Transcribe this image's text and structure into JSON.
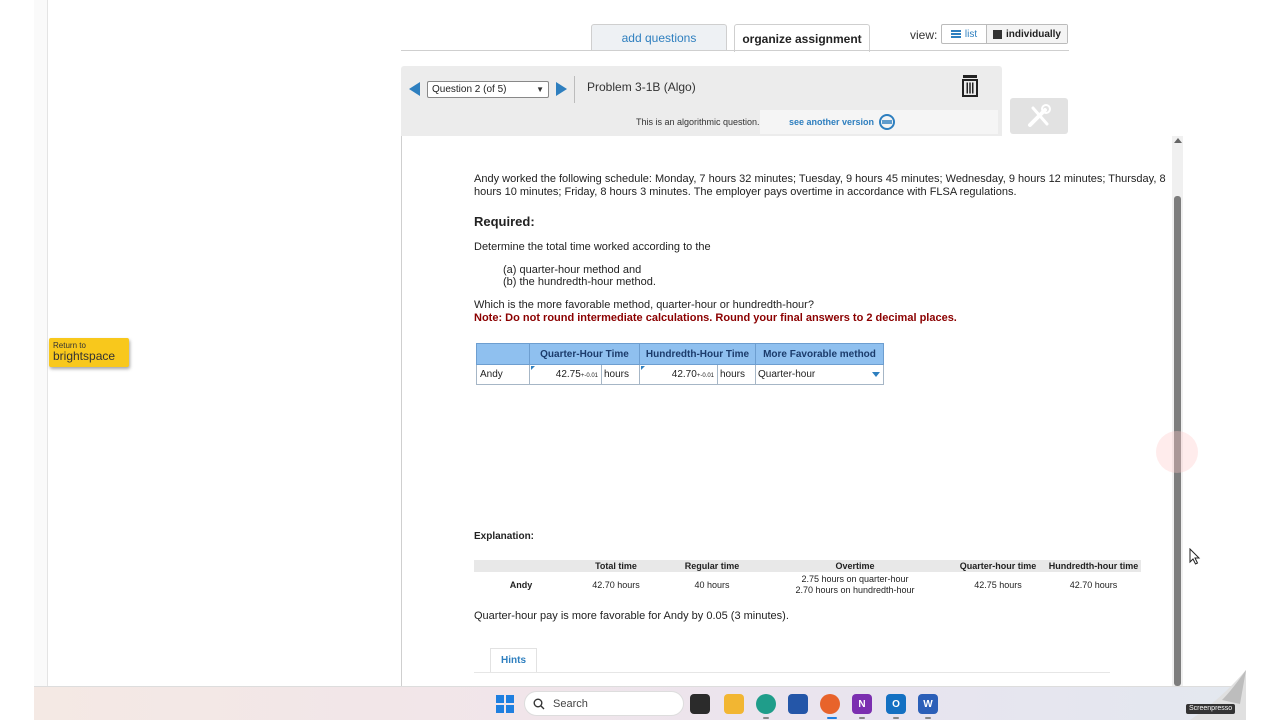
{
  "tabs": {
    "add_questions": "add questions",
    "organize_assignment": "organize assignment"
  },
  "view": {
    "label": "view:",
    "list": "list",
    "individually": "individually"
  },
  "question_nav": {
    "selected": "Question 2 (of 5)",
    "problem_title": "Problem 3-1B (Algo)",
    "algo_text": "This is an algorithmic question.",
    "see_another": "see another version"
  },
  "problem": {
    "text": "Andy worked the following schedule: Monday, 7 hours 32 minutes; Tuesday, 9 hours 45 minutes; Wednesday, 9 hours 12 minutes; Thursday, 8 hours 10 minutes; Friday, 8 hours 3 minutes. The employer pays overtime in accordance with FLSA regulations.",
    "required": "Required:",
    "determine": "Determine the total time worked according to the",
    "part_a": "(a) quarter-hour method and",
    "part_b": "(b) the hundredth-hour method.",
    "which": "Which is the more favorable method, quarter-hour or hundredth-hour?",
    "note": "Note: Do not round intermediate calculations. Round your final answers to 2 decimal places."
  },
  "answer_table": {
    "headers": [
      "Quarter-Hour Time",
      "Hundredth-Hour Time",
      "More Favorable method"
    ],
    "row_label": "Andy",
    "quarter_value": "42.75",
    "hundredth_value": "42.70",
    "tolerance": "+-0.01",
    "unit": "hours",
    "favorable": "Quarter-hour"
  },
  "explanation": {
    "label": "Explanation:",
    "headers": [
      "Total time",
      "Regular time",
      "Overtime",
      "Quarter-hour time",
      "Hundredth-hour time"
    ],
    "row_label": "Andy",
    "total_time": "42.70 hours",
    "regular_time": "40 hours",
    "overtime_line1": "2.75 hours on quarter-hour",
    "overtime_line2": "2.70 hours on hundredth-hour",
    "quarter_time": "42.75 hours",
    "hundredth_time": "42.70 hours",
    "conclusion": "Quarter-hour pay is more favorable for Andy by 0.05 (3 minutes).",
    "hints_tab": "Hints"
  },
  "return_button": {
    "small": "Return to",
    "big": "brightspace"
  },
  "taskbar": {
    "search_placeholder": "Search",
    "screenpresso": "Screenpresso"
  },
  "colors": {
    "accent": "#2e7fbf",
    "table_header": "#8fc0ef",
    "note_red": "#8b0000",
    "return_yellow": "#f8c81c"
  }
}
